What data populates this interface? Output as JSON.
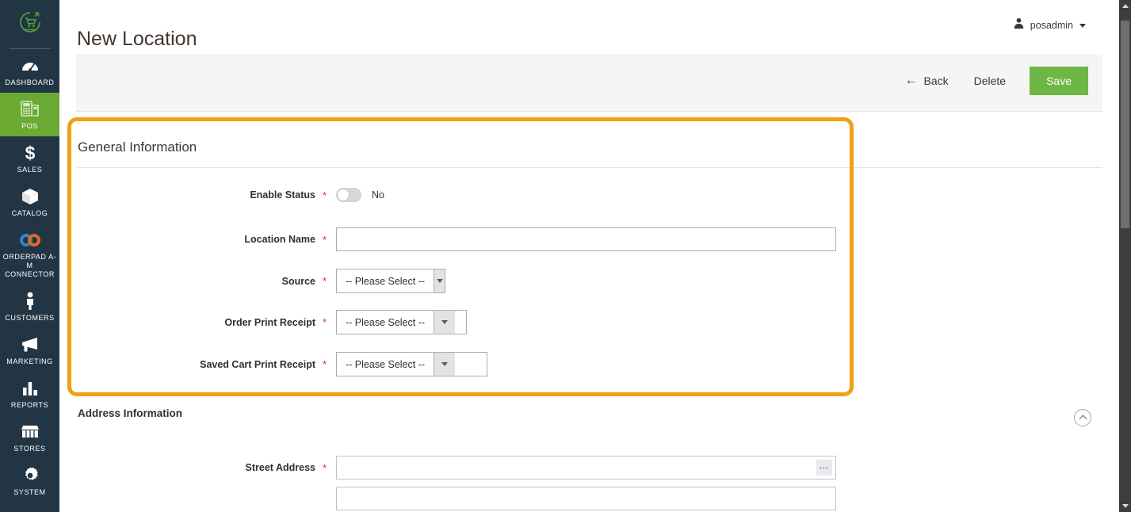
{
  "sidebar": {
    "logo_icon": "shopping-cart-logo-icon",
    "items": [
      {
        "label": "DASHBOARD",
        "icon": "dashboard-gauge-icon",
        "active": false
      },
      {
        "label": "POS",
        "icon": "pos-terminal-icon",
        "active": true
      },
      {
        "label": "SALES",
        "icon": "dollar-sign-icon",
        "active": false
      },
      {
        "label": "CATALOG",
        "icon": "box-icon",
        "active": false
      },
      {
        "label": "ORDERPAD A-M CONNECTOR",
        "icon": "linked-rings-icon",
        "active": false
      },
      {
        "label": "CUSTOMERS",
        "icon": "person-icon",
        "active": false
      },
      {
        "label": "MARKETING",
        "icon": "megaphone-icon",
        "active": false
      },
      {
        "label": "REPORTS",
        "icon": "bar-chart-icon",
        "active": false
      },
      {
        "label": "STORES",
        "icon": "storefront-icon",
        "active": false
      },
      {
        "label": "SYSTEM",
        "icon": "gear-icon",
        "active": false
      }
    ]
  },
  "header": {
    "title": "New Location",
    "user": {
      "name": "posadmin",
      "avatar_icon": "user-avatar-icon",
      "caret_icon": "caret-down-icon"
    }
  },
  "toolbar": {
    "back_label": "Back",
    "back_icon": "arrow-left-icon",
    "delete_label": "Delete",
    "save_label": "Save",
    "save_color": "#6eb744"
  },
  "general_information": {
    "title": "General Information",
    "highlight_color": "#eca313",
    "fields": {
      "enable_status": {
        "label": "Enable Status",
        "required": "*",
        "toggle_state": "off",
        "toggle_text": "No"
      },
      "location_name": {
        "label": "Location Name",
        "required": "*",
        "value": "",
        "placeholder": ""
      },
      "source": {
        "label": "Source",
        "required": "*",
        "selected": "-- Please Select --",
        "dropdown_icon": "caret-down-icon"
      },
      "order_print_receipt": {
        "label": "Order Print Receipt",
        "required": "*",
        "selected": "-- Please Select --",
        "dropdown_icon": "caret-down-icon"
      },
      "saved_cart_print_receipt": {
        "label": "Saved Cart Print Receipt",
        "required": "*",
        "selected": "-- Please Select --",
        "dropdown_icon": "caret-down-icon"
      }
    }
  },
  "address_information": {
    "title": "Address Information",
    "collapse_icon": "chevron-up-circle-icon",
    "fields": {
      "street_address": {
        "label": "Street Address",
        "required": "*",
        "line1_value": "",
        "line1_placeholder": "",
        "line2_value": "",
        "line2_placeholder": "",
        "more_icon": "ellipsis-icon"
      }
    }
  },
  "scrollbar": {
    "up_icon": "scroll-up-arrow-icon",
    "down_icon": "scroll-down-arrow-icon",
    "thumb": "scrollbar-thumb"
  }
}
